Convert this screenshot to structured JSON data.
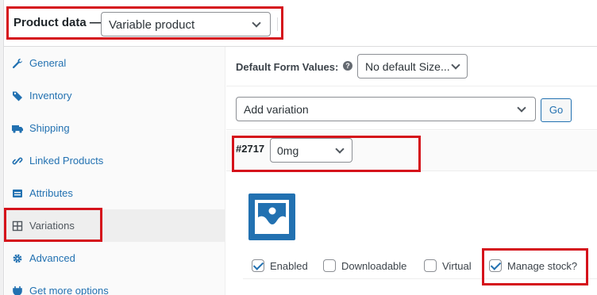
{
  "header": {
    "title": "Product data —",
    "product_type": "Variable product"
  },
  "sidebar": {
    "items": [
      {
        "label": "General",
        "icon": "wrench-icon"
      },
      {
        "label": "Inventory",
        "icon": "tag-icon"
      },
      {
        "label": "Shipping",
        "icon": "truck-icon"
      },
      {
        "label": "Linked Products",
        "icon": "link-icon"
      },
      {
        "label": "Attributes",
        "icon": "list-icon"
      },
      {
        "label": "Variations",
        "icon": "grid-icon",
        "active": true
      },
      {
        "label": "Advanced",
        "icon": "gear-icon"
      },
      {
        "label": "Get more options",
        "icon": "plugin-icon"
      }
    ]
  },
  "defaults": {
    "label": "Default Form Values:",
    "help": "?",
    "selected": "No default Size..."
  },
  "add_variation": {
    "selected": "Add variation",
    "go_label": "Go"
  },
  "variation": {
    "id": "#2717",
    "size": "0mg",
    "checkboxes": [
      {
        "label": "Enabled",
        "checked": true
      },
      {
        "label": "Downloadable",
        "checked": false
      },
      {
        "label": "Virtual",
        "checked": false
      },
      {
        "label": "Manage stock?",
        "checked": true
      }
    ]
  },
  "colors": {
    "accent": "#2271b1",
    "highlight_box": "#d5121b"
  }
}
